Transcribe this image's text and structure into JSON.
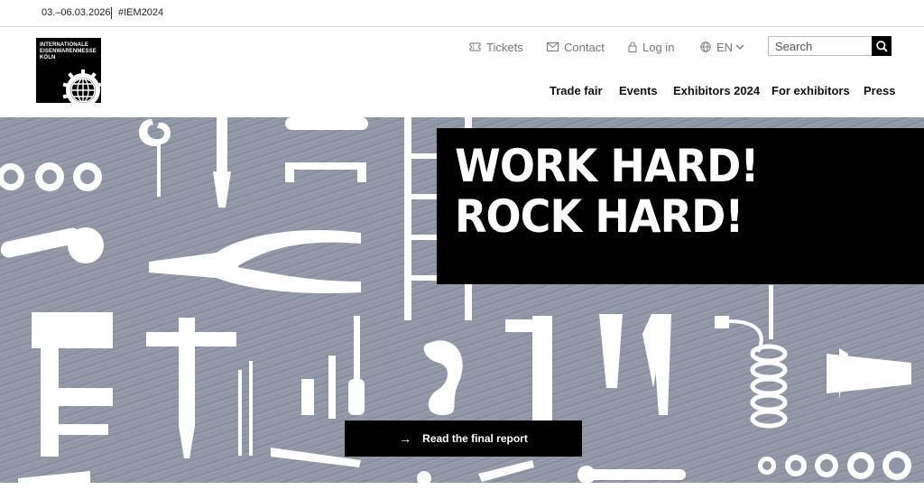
{
  "topbar": {
    "date": "03.–06.03.2026",
    "hashtag": "#IEM2024"
  },
  "logo": {
    "line1": "INTERNATIONALE",
    "line2": "EISENWARENMESSE",
    "line3": "KÖLN"
  },
  "util_nav": {
    "tickets": "Tickets",
    "contact": "Contact",
    "login": "Log in",
    "language": "EN"
  },
  "search": {
    "placeholder": "Search"
  },
  "main_nav": {
    "trade_fair": "Trade fair",
    "events": "Events",
    "exhibitors_2024": "Exhibitors 2024",
    "for_exhibitors": "For exhibitors",
    "press": "Press"
  },
  "hero": {
    "headline_line1": "WORK HARD!",
    "headline_line2": "ROCK HARD!",
    "cta_label": "Read the final report",
    "cta_icon": "arrow-right-icon"
  },
  "colors": {
    "brand_black": "#000000",
    "hero_background": "#9096a6",
    "tool_silhouettes": "#ffffff"
  }
}
